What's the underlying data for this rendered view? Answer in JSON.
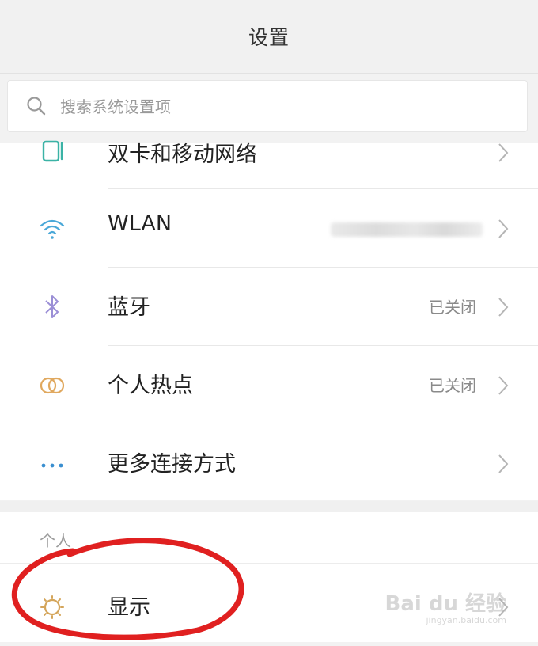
{
  "header": {
    "title": "设置"
  },
  "search": {
    "placeholder": "搜索系统设置项"
  },
  "connectivity": {
    "items": [
      {
        "label": "双卡和移动网络",
        "status": "",
        "icon": "sim-card-icon"
      },
      {
        "label": "WLAN",
        "status": "",
        "icon": "wifi-icon"
      },
      {
        "label": "蓝牙",
        "status": "已关闭",
        "icon": "bluetooth-icon"
      },
      {
        "label": "个人热点",
        "status": "已关闭",
        "icon": "hotspot-icon"
      },
      {
        "label": "更多连接方式",
        "status": "",
        "icon": "more-dots-icon"
      }
    ]
  },
  "personal": {
    "section_title": "个人",
    "items": [
      {
        "label": "显示",
        "icon": "brightness-icon"
      }
    ]
  },
  "watermark": {
    "main": "Bai du 经验",
    "sub": "jingyan.baidu.com"
  },
  "colors": {
    "sim_icon": "#3bb3a6",
    "wifi_icon": "#4aa8d8",
    "bluetooth_icon": "#9b8fd6",
    "hotspot_icon": "#e0a85e",
    "more_icon": "#3a8fd0",
    "display_icon": "#d4a55a",
    "annotation_red": "#e02020"
  }
}
